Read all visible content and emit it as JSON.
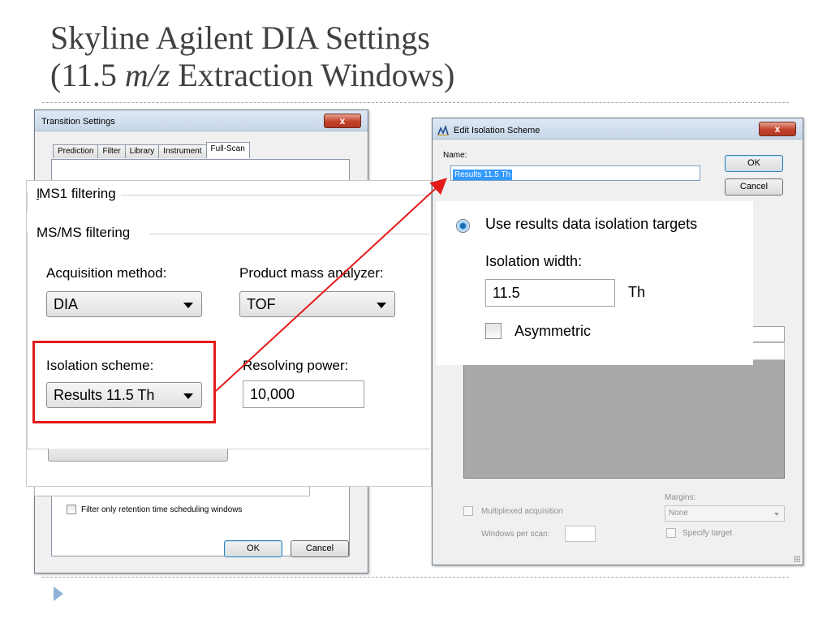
{
  "slide": {
    "title_line1": "Skyline Agilent DIA Settings",
    "title_line2_pre": "(11.5 ",
    "title_line2_italic": "m/z",
    "title_line2_post": " Extraction Windows)"
  },
  "left_dialog": {
    "title": "Transition Settings",
    "close_label": "x",
    "tabs": [
      "Prediction",
      "Filter",
      "Library",
      "Instrument",
      "Full-Scan"
    ],
    "active_tab": "Full-Scan",
    "checkbox_label": "Filter only retention time scheduling windows",
    "ok_label": "OK",
    "cancel_label": "Cancel"
  },
  "zoom_panel": {
    "ms1_filtering": "MS1 filtering",
    "msms_filtering": "MS/MS filtering",
    "acquisition_method_label": "Acquisition method:",
    "acquisition_method_value": "DIA",
    "product_mass_analyzer_label": "Product mass analyzer:",
    "product_mass_analyzer_value": "TOF",
    "isolation_scheme_label": "Isolation scheme:",
    "isolation_scheme_value": "Results 11.5 Th",
    "resolving_power_label": "Resolving power:",
    "resolving_power_value": "10,000"
  },
  "right_dialog": {
    "title": "Edit Isolation Scheme",
    "close_label": "x",
    "name_label": "Name:",
    "name_value": "Results 11.5 Th",
    "ok_label": "OK",
    "cancel_label": "Cancel",
    "multiplexed_label": "Multiplexed acquisition",
    "windows_per_scan_label": "Windows per scan:",
    "margins_label": "Margins:",
    "margins_value": "None",
    "specify_target_label": "Specify target"
  },
  "zoom_panel_2": {
    "use_results_label": "Use results data isolation targets",
    "isolation_width_label": "Isolation width:",
    "isolation_width_value": "11.5",
    "isolation_width_unit": "Th",
    "asymmetric_label": "Asymmetric"
  },
  "colors": {
    "highlight": "#e31b1b",
    "arrow": "#e31b1b",
    "title_text": "#404040",
    "bullet": "#8eb3d6"
  },
  "icons": {
    "close": "close-icon",
    "dropdown": "chevron-down-icon",
    "app": "skyline-app-icon",
    "bullet": "triangle-bullet-icon"
  }
}
